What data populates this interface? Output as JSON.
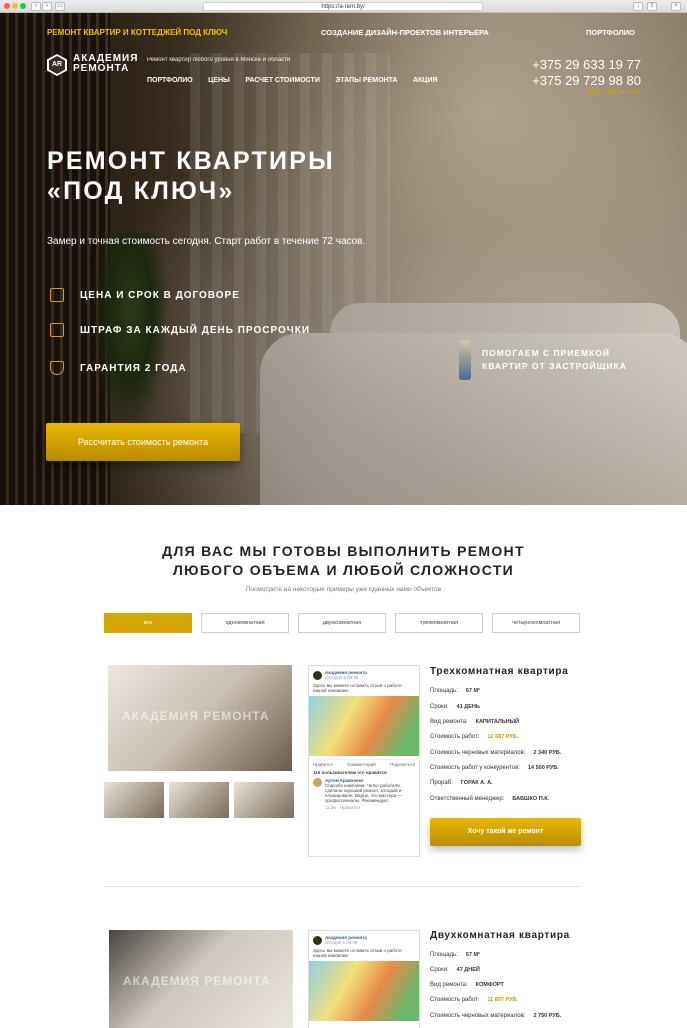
{
  "browser": {
    "url": "https://a-rem.by/"
  },
  "topbar": {
    "left_link": "РЕМОНТ КВАРТИР И КОТТЕДЖЕЙ ПОД КЛЮЧ",
    "center_link": "СОЗДАНИЕ ДИЗАЙН-ПРОЕКТОВ ИНТЕРЬЕРА",
    "right_link": "ПОРТФОЛИО"
  },
  "header": {
    "logo_mark": "AR",
    "logo_line1": "АКАДЕМИЯ",
    "logo_line2": "РЕМОНТА",
    "tagline": "Ремонт квартир любого уровня в Минске и области",
    "nav": [
      "ПОРТФОЛИО",
      "ЦЕНЫ",
      "РАСЧЕТ СТОИМОСТИ",
      "ЭТАПЫ РЕМОНТА",
      "АКЦИЯ"
    ],
    "phone1": "+375 29 633 19 77",
    "phone2": "+375 29 729 98 80",
    "callback": "ПЛАТНЫЙ ЗВОНОК"
  },
  "hero": {
    "title_line1": "РЕМОНТ КВАРТИРЫ",
    "title_line2": "«ПОД КЛЮЧ»",
    "subtitle": "Замер и точная стоимость сегодня. Старт работ в течение 72 часов.",
    "features": [
      {
        "icon": "document-icon",
        "text": "ЦЕНА И СРОК В ДОГОВОРЕ"
      },
      {
        "icon": "calendar-icon",
        "text": "ШТРАФ ЗА КАЖДЫЙ ДЕНЬ ПРОСРОЧКИ"
      },
      {
        "icon": "shield-icon",
        "text": "ГАРАНТИЯ 2 ГОДА"
      }
    ],
    "promo_line1": "ПОМОГАЕМ С ПРИЕМКОЙ",
    "promo_line2": "КВАРТИР ОТ ЗАСТРОЙЩИКА",
    "cta": "Рассчитать стоимость ремонта"
  },
  "portfolio": {
    "title_line1": "ДЛЯ ВАС МЫ ГОТОВЫ ВЫПОЛНИТЬ РЕМОНТ",
    "title_line2": "ЛЮБОГО ОБЪЕМА И ЛЮБОЙ СЛОЖНОСТИ",
    "subtitle": "Посмотрите на некоторые примеры уже сданных нами объектов",
    "tabs": [
      "все",
      "однокомнатная",
      "двухкомнатная",
      "трехкомнатная",
      "четырехкомнатная"
    ],
    "watermark": "АКАДЕМИЯ РЕМОНТА",
    "projects": [
      {
        "title": "Трехкомнатная квартира",
        "rows": [
          {
            "label": "Площадь:",
            "value": "67 М²"
          },
          {
            "label": "Сроки:",
            "value": "41 ДЕНЬ"
          },
          {
            "label": "Вид ремонта:",
            "value": "КАПИТАЛЬНЫЙ"
          },
          {
            "label": "Стоимость работ:",
            "value": "12 687 РУБ."
          },
          {
            "label": "Стоимость черновых материалов:",
            "value": "2 340 РУБ."
          },
          {
            "label": "Стоимость работ у конкурентов:",
            "value": "14 500 РУБ."
          },
          {
            "label": "Прораб:",
            "value": "ГОРАК А. А."
          },
          {
            "label": "Ответственный менеджер:",
            "value": "БАБШКО П.К."
          }
        ],
        "button": "Хочу такой же ремонт",
        "review": {
          "page_name": "Академия ремонта",
          "date": "Сегодня в 09:36",
          "intro": "Здесь вы можете оставить отзыв о работе нашей компании.",
          "actions": [
            "Нравится",
            "Комментарий",
            "Поделиться"
          ],
          "likes": "116 пользователям это нравится",
          "author": "Артем Кравченко",
          "text": "Спасибо компании. Четко работали, сделали хороший ремонт, который и планировали. Видно, что мастера — профессионалы. Рекомендую.",
          "meta": "11:36 · Нравится"
        }
      },
      {
        "title": "Двухкомнатная квартира",
        "rows": [
          {
            "label": "Площадь:",
            "value": "57 М²"
          },
          {
            "label": "Сроки:",
            "value": "47 ДНЕЙ"
          },
          {
            "label": "Вид ремонта:",
            "value": "КОМФОРТ"
          },
          {
            "label": "Стоимость работ:",
            "value": "11 857 РУБ."
          },
          {
            "label": "Стоимость черновых материалов:",
            "value": "2 750 РУБ."
          }
        ],
        "review": {
          "page_name": "Академия ремонта",
          "date": "сегодня в 09:36",
          "intro": "Здесь вы можете оставить отзыв о работе нашей компании."
        }
      }
    ]
  }
}
